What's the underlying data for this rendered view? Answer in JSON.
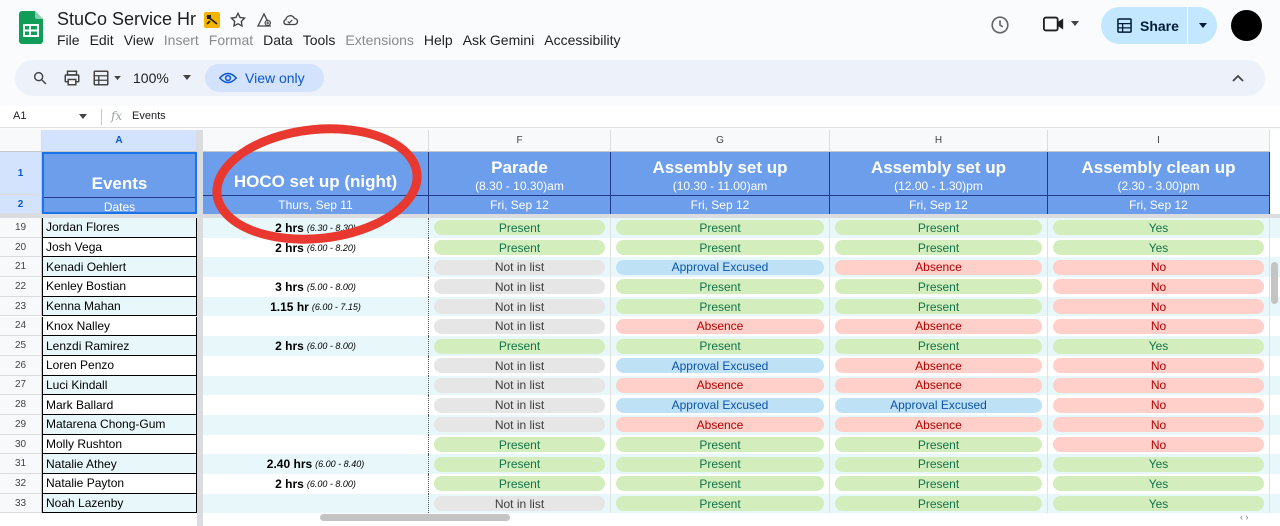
{
  "doc": {
    "title": "StuCo Service Hr"
  },
  "menu": [
    {
      "label": "File",
      "enabled": true
    },
    {
      "label": "Edit",
      "enabled": true
    },
    {
      "label": "View",
      "enabled": true
    },
    {
      "label": "Insert",
      "enabled": false
    },
    {
      "label": "Format",
      "enabled": false
    },
    {
      "label": "Data",
      "enabled": true
    },
    {
      "label": "Tools",
      "enabled": true
    },
    {
      "label": "Extensions",
      "enabled": false
    },
    {
      "label": "Help",
      "enabled": true
    },
    {
      "label": "Ask Gemini",
      "enabled": true
    },
    {
      "label": "Accessibility",
      "enabled": true
    }
  ],
  "share": {
    "label": "Share"
  },
  "toolbar": {
    "zoom": "100%",
    "view_only": "View only"
  },
  "formula": {
    "cell_ref": "A1",
    "value": "Events"
  },
  "columns": [
    "A",
    "",
    "F",
    "G",
    "H",
    "I"
  ],
  "header_rows": [
    "1",
    "2"
  ],
  "headers": {
    "events": {
      "title": "Events",
      "sub": "Dates"
    },
    "hoco": {
      "title": "HOCO set up (night)",
      "date": "Thurs, Sep 11"
    },
    "parade": {
      "title": "Parade",
      "time": "(8.30 - 10.30)am",
      "date": "Fri, Sep 12"
    },
    "assembly1": {
      "title": "Assembly set up",
      "time": "(10.30 - 11.00)am",
      "date": "Fri, Sep 12"
    },
    "assembly2": {
      "title": "Assembly set up",
      "time": "(12.00 - 1.30)pm",
      "date": "Fri, Sep 12"
    },
    "cleanup": {
      "title": "Assembly clean up",
      "time": "(2.30 - 3.00)pm",
      "date": "Fri, Sep 12"
    }
  },
  "rows": [
    {
      "num": "19",
      "name": "Jordan Flores",
      "hrs": "2 hrs",
      "range": "(6.30 - 8.30)",
      "f": "Present",
      "g": "Present",
      "h": "Present",
      "i": "Yes"
    },
    {
      "num": "20",
      "name": "Josh Vega",
      "hrs": "2 hrs",
      "range": "(6.00 - 8.20)",
      "f": "Present",
      "g": "Present",
      "h": "Present",
      "i": "Yes"
    },
    {
      "num": "21",
      "name": "Kenadi Oehlert",
      "hrs": "",
      "range": "",
      "f": "Not in list",
      "g": "Approval Excused",
      "h": "Absence",
      "i": "No"
    },
    {
      "num": "22",
      "name": "Kenley Bostian",
      "hrs": "3 hrs",
      "range": "(5.00 - 8.00)",
      "f": "Not in list",
      "g": "Present",
      "h": "Present",
      "i": "No"
    },
    {
      "num": "23",
      "name": "Kenna Mahan",
      "hrs": "1.15 hr",
      "range": "(6.00 - 7.15)",
      "f": "Not in list",
      "g": "Present",
      "h": "Present",
      "i": "No"
    },
    {
      "num": "24",
      "name": "Knox Nalley",
      "hrs": "",
      "range": "",
      "f": "Not in list",
      "g": "Absence",
      "h": "Absence",
      "i": "No"
    },
    {
      "num": "25",
      "name": "Lenzdi Ramirez",
      "hrs": "2 hrs",
      "range": "(6.00 - 8.00)",
      "f": "Present",
      "g": "Present",
      "h": "Present",
      "i": "Yes"
    },
    {
      "num": "26",
      "name": "Loren Penzo",
      "hrs": "",
      "range": "",
      "f": "Not in list",
      "g": "Approval Excused",
      "h": "Absence",
      "i": "No"
    },
    {
      "num": "27",
      "name": "Luci Kindall",
      "hrs": "",
      "range": "",
      "f": "Not in list",
      "g": "Absence",
      "h": "Absence",
      "i": "No"
    },
    {
      "num": "28",
      "name": "Mark Ballard",
      "hrs": "",
      "range": "",
      "f": "Not in list",
      "g": "Approval Excused",
      "h": "Approval Excused",
      "i": "No"
    },
    {
      "num": "29",
      "name": "Matarena Chong-Gum",
      "hrs": "",
      "range": "",
      "f": "Not in list",
      "g": "Absence",
      "h": "Absence",
      "i": "No"
    },
    {
      "num": "30",
      "name": "Molly Rushton",
      "hrs": "",
      "range": "",
      "f": "Present",
      "g": "Present",
      "h": "Present",
      "i": "No"
    },
    {
      "num": "31",
      "name": "Natalie Athey",
      "hrs": "2.40 hrs",
      "range": "(6.00 - 8.40)",
      "f": "Present",
      "g": "Present",
      "h": "Present",
      "i": "Yes"
    },
    {
      "num": "32",
      "name": "Natalie Payton",
      "hrs": "2 hrs",
      "range": "(6.00 - 8.00)",
      "f": "Present",
      "g": "Present",
      "h": "Present",
      "i": "Yes"
    },
    {
      "num": "33",
      "name": "Noah Lazenby",
      "hrs": "",
      "range": "",
      "f": "Not in list",
      "g": "Present",
      "h": "Present",
      "i": "Yes"
    }
  ],
  "colors": {
    "header_blue": "#6d9eeb",
    "present": "#d4edbc",
    "not_in_list": "#e6e6e6",
    "excused": "#bfe1f6",
    "absence": "#ffcfc9",
    "annotation_red": "#e8382f"
  },
  "icons": [
    "sheets-logo-icon",
    "folder-icon",
    "star-icon",
    "move-icon",
    "cloud-icon",
    "history-icon",
    "meet-icon",
    "lock-icon",
    "search-icon",
    "print-icon",
    "format-icon",
    "eye-icon",
    "chevron-up-icon"
  ]
}
